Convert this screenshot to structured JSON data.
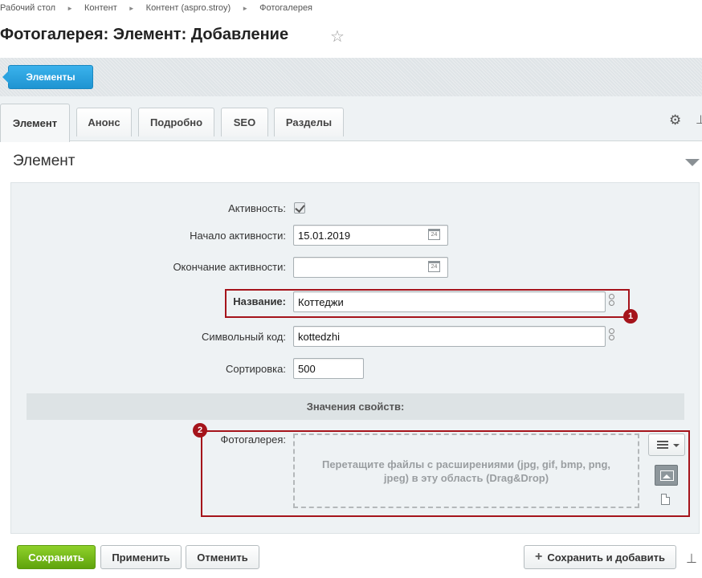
{
  "breadcrumb": [
    "Рабочий стол",
    "Контент",
    "Контент (aspro.stroy)",
    "Фотогалерея"
  ],
  "page_title": "Фотогалерея: Элемент: Добавление",
  "toolbar": {
    "elements_label": "Элементы"
  },
  "tabs": [
    "Элемент",
    "Анонс",
    "Подробно",
    "SEO",
    "Разделы"
  ],
  "section": {
    "title": "Элемент"
  },
  "form": {
    "active_label": "Активность:",
    "active_checked": true,
    "start_label": "Начало активности:",
    "start_value": "15.01.2019",
    "end_label": "Окончание активности:",
    "end_value": "",
    "name_label": "Название:",
    "name_value": "Коттеджи",
    "code_label": "Символьный код:",
    "code_value": "kottedzhi",
    "sort_label": "Сортировка:",
    "sort_value": "500",
    "calendar_day": "24"
  },
  "properties": {
    "header": "Значения свойств:",
    "gallery_label": "Фотогалерея:",
    "dropzone_text": "Перетащите файлы с расширениями (jpg, gif, bmp, png, jpeg) в эту область (Drag&Drop)"
  },
  "markers": [
    "1",
    "2"
  ],
  "buttons": {
    "save": "Сохранить",
    "apply": "Применить",
    "cancel": "Отменить",
    "save_and_add": "Сохранить и добавить"
  },
  "icons": {
    "star": "star-icon",
    "gear": "gear-icon",
    "pin": "pin-icon",
    "calendar": "calendar-icon",
    "link": "link-icon",
    "menu": "menu-icon",
    "image": "image-icon",
    "file": "file-icon"
  },
  "colors": {
    "accent_blue": "#1e94d2",
    "save_green": "#6ab416",
    "highlight_red": "#a5141b"
  }
}
